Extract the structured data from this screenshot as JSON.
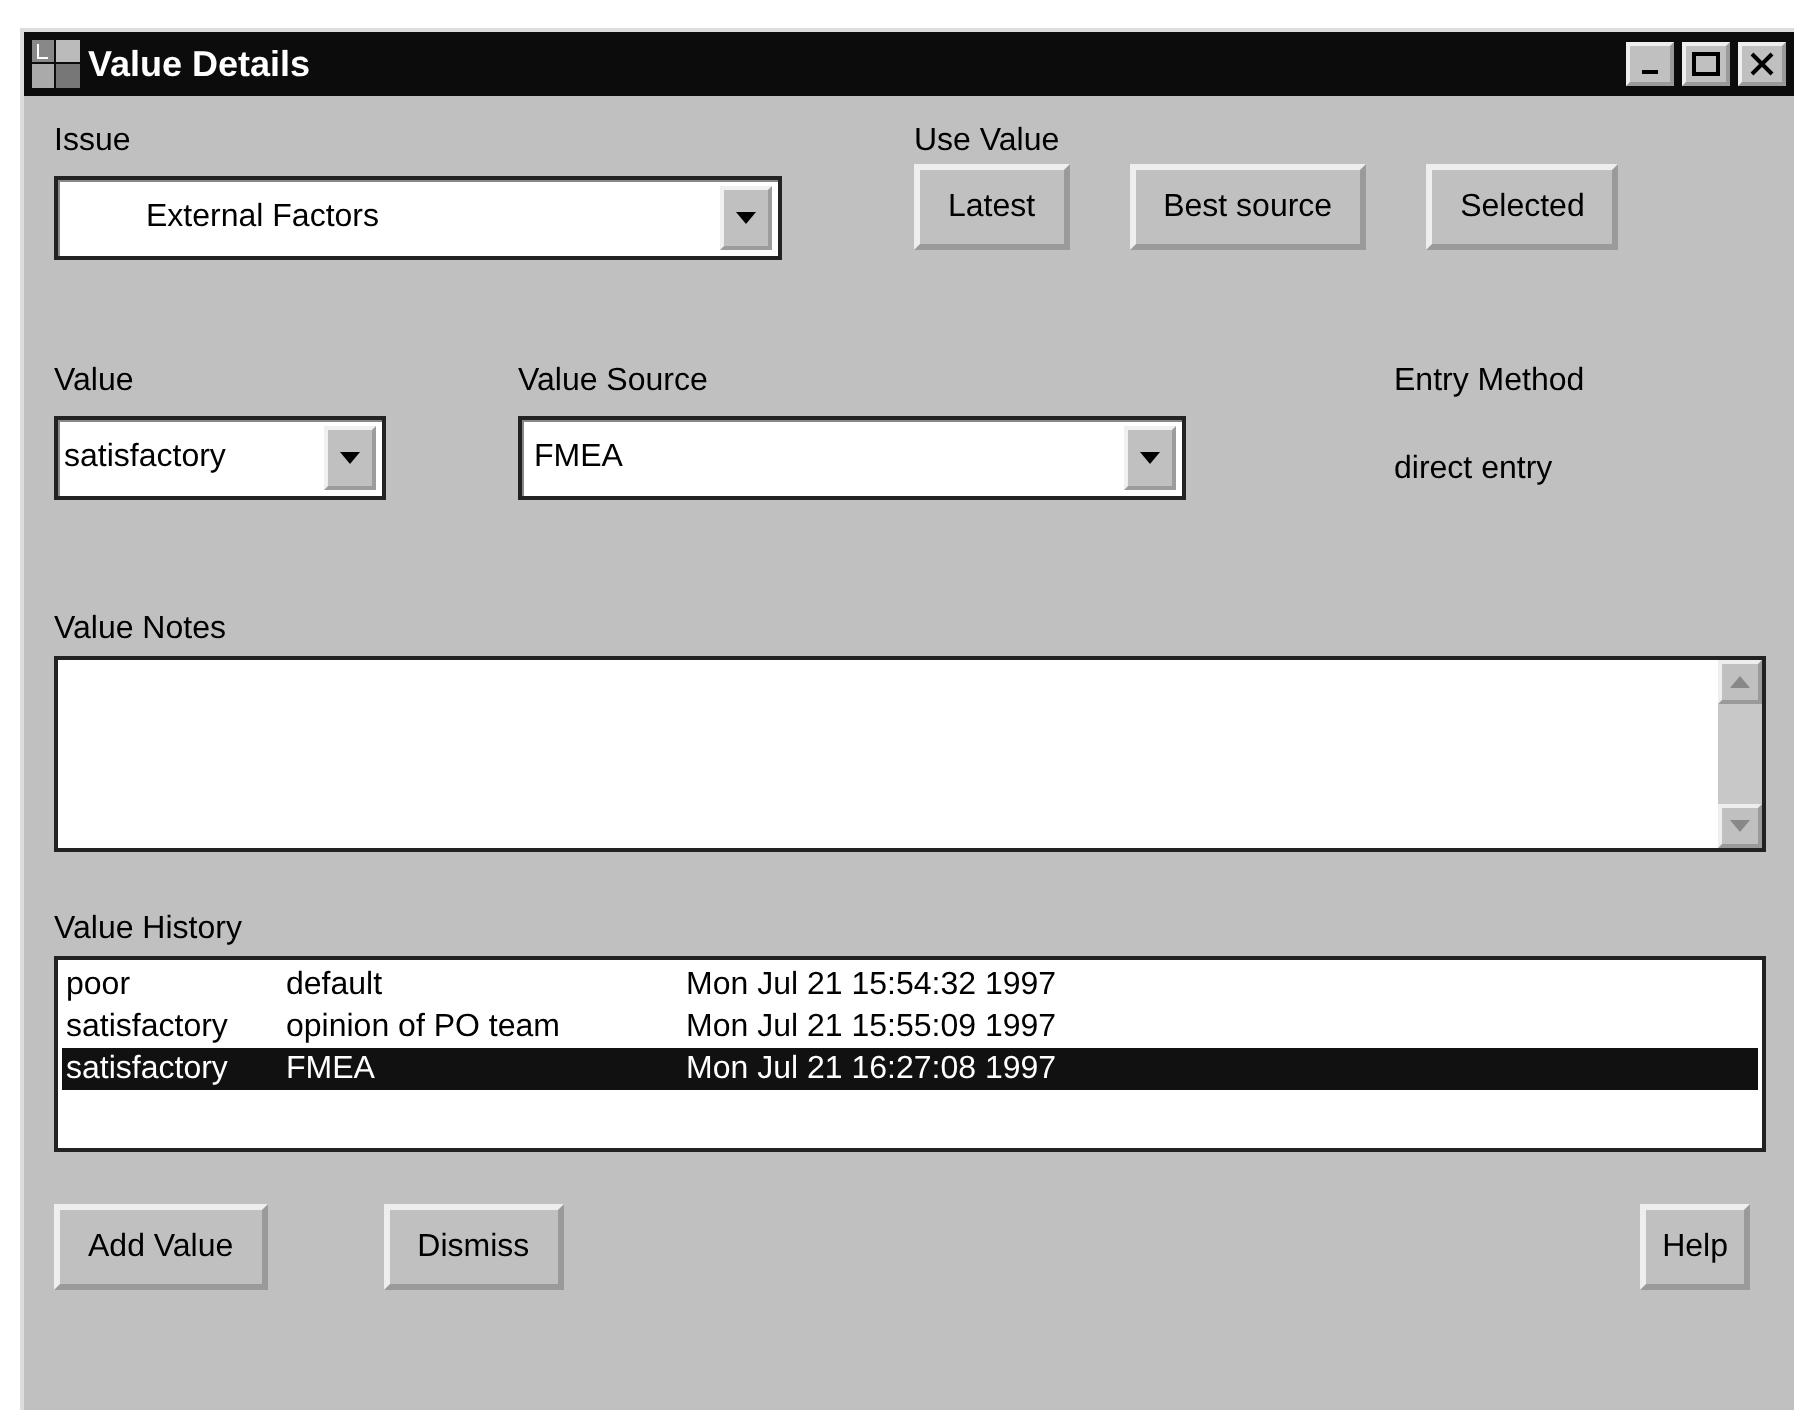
{
  "window": {
    "title": "Value Details"
  },
  "issue": {
    "label": "Issue",
    "value": "External Factors"
  },
  "use_value": {
    "label": "Use Value",
    "buttons": [
      "Latest",
      "Best source",
      "Selected"
    ]
  },
  "value": {
    "label": "Value",
    "value": "satisfactory"
  },
  "value_source": {
    "label": "Value Source",
    "value": "FMEA"
  },
  "entry_method": {
    "label": "Entry Method",
    "value": "direct entry"
  },
  "value_notes": {
    "label": "Value Notes"
  },
  "value_history": {
    "label": "Value History",
    "rows": [
      {
        "value": "poor",
        "source": "default",
        "time": "Mon Jul 21 15:54:32 1997",
        "selected": false
      },
      {
        "value": "satisfactory",
        "source": "opinion of PO team",
        "time": "Mon Jul 21 15:55:09 1997",
        "selected": false
      },
      {
        "value": "satisfactory",
        "source": "FMEA",
        "time": "Mon Jul 21 16:27:08 1997",
        "selected": true
      }
    ]
  },
  "buttons": [
    "Add Value",
    "Dismiss",
    "Help"
  ]
}
